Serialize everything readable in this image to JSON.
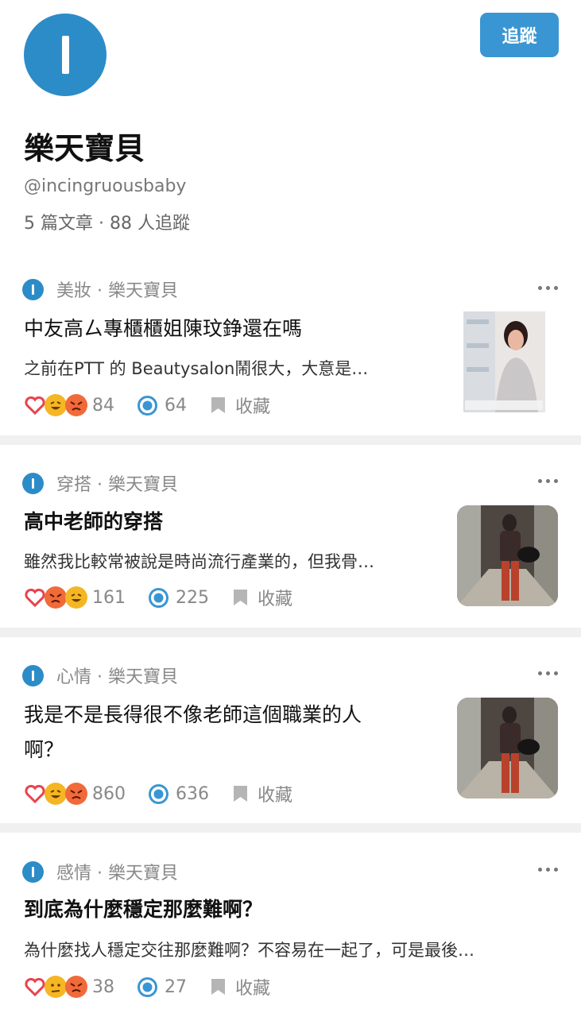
{
  "profile": {
    "name": "樂天寶貝",
    "handle": "@incingruousbaby",
    "stats": "5 篇文章 · 88 人追蹤",
    "follow_label": "追蹤",
    "accent": "#3a96d2"
  },
  "posts": [
    {
      "meta": "美妝 · 樂天寶貝",
      "title": "中友高ㄙ專櫃櫃姐陳玟錚還在嗎",
      "excerpt": "之前在PTT 的 Beautysalon鬧很大，大意是…",
      "reactions": [
        "heart",
        "laugh",
        "angry"
      ],
      "reaction_count": "84",
      "comment_count": "64",
      "save_label": "收藏"
    },
    {
      "meta": "穿搭 · 樂天寶貝",
      "title": "高中老師的穿搭",
      "excerpt": "雖然我比較常被說是時尚流行產業的，但我骨…",
      "reactions": [
        "heart",
        "angry",
        "laugh"
      ],
      "reaction_count": "161",
      "comment_count": "225",
      "save_label": "收藏"
    },
    {
      "meta": "心情 · 樂天寶貝",
      "title_line1": "我是不是長得很不像老師這個職業的人",
      "title_line2": "啊？",
      "reactions": [
        "heart",
        "laugh",
        "angry"
      ],
      "reaction_count": "860",
      "comment_count": "636",
      "save_label": "收藏"
    },
    {
      "meta": "感情 · 樂天寶貝",
      "title": "到底為什麼穩定那麼難啊？",
      "excerpt": "為什麼找人穩定交往那麼難啊？不容易在一起了，可是最後…",
      "reactions": [
        "heart",
        "grumpy",
        "angry"
      ],
      "reaction_count": "38",
      "comment_count": "27",
      "save_label": "收藏"
    }
  ]
}
